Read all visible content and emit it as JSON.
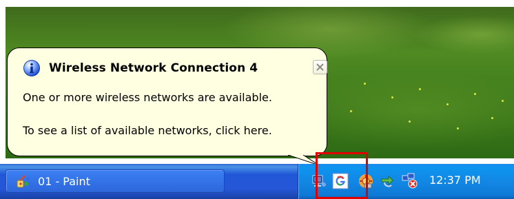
{
  "balloon": {
    "title": "Wireless Network Connection 4",
    "line1": "One or more wireless networks are available.",
    "line2": "To see a list of available networks, click here.",
    "title_icon": "info-icon",
    "close_icon": "close-icon"
  },
  "taskbar": {
    "task_button_label": "01 - Paint",
    "task_button_icon": "paint-icon",
    "clock": "12:37 PM",
    "tray_icons": [
      "network-icon",
      "google-icon",
      "security-icon",
      "sync-icon",
      "network-error-icon"
    ]
  },
  "colors": {
    "balloon_bg": "#ffffe1",
    "taskbar_blue": "#2557d8",
    "tray_blue": "#0f79d6",
    "highlight_red": "#e10000"
  }
}
